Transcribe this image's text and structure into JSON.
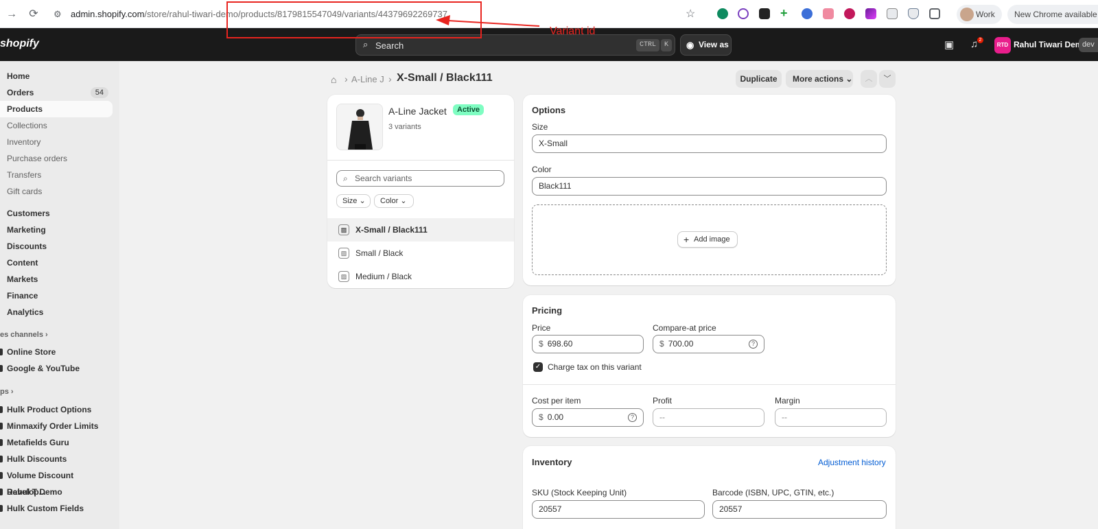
{
  "browser": {
    "url_host": "admin.shopify.com",
    "url_path": "/store/rahul-tiwari-demo/products/8179815547049/variants/44379692269737",
    "profile_label": "Work",
    "update_label": "New Chrome available"
  },
  "annotation": {
    "label": "Variant id",
    "color": "#e8241f"
  },
  "topbar": {
    "logo": "shopify",
    "search_placeholder": "Search",
    "shortcut_ctrl": "CTRL",
    "shortcut_key": "K",
    "view_as": "View as",
    "notification_count": "2",
    "avatar_initials": "RTD",
    "store_name": "Rahul Tiwari Demo",
    "dev_label": "dev"
  },
  "sidebar": {
    "items": [
      {
        "label": "Home"
      },
      {
        "label": "Orders",
        "count": "54"
      },
      {
        "label": "Products"
      },
      {
        "label": "Collections"
      },
      {
        "label": "Inventory"
      },
      {
        "label": "Purchase orders"
      },
      {
        "label": "Transfers"
      },
      {
        "label": "Gift cards"
      },
      {
        "label": "Customers"
      },
      {
        "label": "Marketing"
      },
      {
        "label": "Discounts"
      },
      {
        "label": "Content"
      },
      {
        "label": "Markets"
      },
      {
        "label": "Finance"
      },
      {
        "label": "Analytics"
      }
    ],
    "sales_channels_label": "es channels",
    "channels": [
      {
        "label": "Online Store"
      },
      {
        "label": "Google & YouTube"
      }
    ],
    "apps_label": "ps",
    "apps": [
      {
        "label": "Hulk Product Options"
      },
      {
        "label": "Minmaxify Order Limits"
      },
      {
        "label": "Metafields Guru"
      },
      {
        "label": "Hulk Discounts"
      },
      {
        "label": "Volume Discount Develop..."
      },
      {
        "label": "Rahul T Demo"
      },
      {
        "label": "Hulk Custom Fields"
      }
    ]
  },
  "page": {
    "breadcrumb_parent": "A-Line J",
    "title": "X-Small / Black111",
    "duplicate": "Duplicate",
    "more_actions": "More actions"
  },
  "product_card": {
    "name": "A-Line Jacket",
    "status": "Active",
    "variant_count": "3 variants",
    "search_placeholder": "Search variants",
    "filters": [
      "Size",
      "Color"
    ],
    "variants": [
      {
        "label": "X-Small / Black111"
      },
      {
        "label": "Small / Black"
      },
      {
        "label": "Medium / Black"
      }
    ]
  },
  "options": {
    "title": "Options",
    "size_label": "Size",
    "size_value": "X-Small",
    "color_label": "Color",
    "color_value": "Black111",
    "add_image": "Add image"
  },
  "pricing": {
    "title": "Pricing",
    "price_label": "Price",
    "currency": "$",
    "price_value": "698.60",
    "compare_label": "Compare-at price",
    "compare_value": "700.00",
    "charge_tax_label": "Charge tax on this variant",
    "cost_label": "Cost per item",
    "cost_value": "0.00",
    "profit_label": "Profit",
    "profit_value": "--",
    "margin_label": "Margin",
    "margin_value": "--"
  },
  "inventory": {
    "title": "Inventory",
    "history_link": "Adjustment history",
    "sku_label": "SKU (Stock Keeping Unit)",
    "sku_value": "20557",
    "barcode_label": "Barcode (ISBN, UPC, GTIN, etc.)",
    "barcode_value": "20557"
  }
}
